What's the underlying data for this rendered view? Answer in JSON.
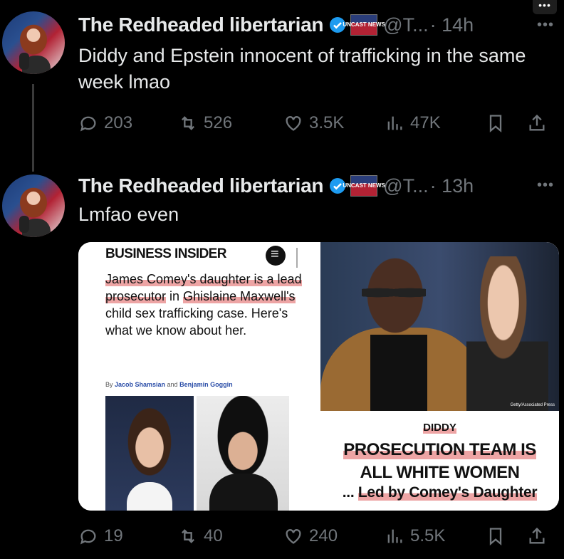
{
  "top_more": "•••",
  "tweets": [
    {
      "name": "The Redheaded libertarian",
      "badge": "UNCAST NEWS",
      "handle": "@T...",
      "time": "· 14h",
      "more": "•••",
      "text": "Diddy and Epstein innocent of trafficking in the same week lmao",
      "replies": "203",
      "reposts": "526",
      "likes": "3.5K",
      "views": "47K"
    },
    {
      "name": "The Redheaded libertarian",
      "badge": "UNCAST NEWS",
      "handle": "@T...",
      "time": "· 13h",
      "more": "•••",
      "text": "Lmfao even",
      "replies": "19",
      "reposts": "40",
      "likes": "240",
      "views": "5.5K"
    }
  ],
  "media": {
    "left": {
      "brand": "BUSINESS INSIDER",
      "title_parts": [
        "James Comey's daughter",
        " is a lead prosecutor",
        " in ",
        "Ghislaine Maxwell's",
        " child sex trafficking case. Here's what we know about her."
      ],
      "byline_prefix": "By ",
      "author1": "Jacob Shamsian",
      "byline_and": " and ",
      "author2": "Benjamin Goggin"
    },
    "right": {
      "credit": "Getty/Associated Press",
      "line1": "DIDDY",
      "line2": "PROSECUTION TEAM IS",
      "line3": "ALL WHITE WOMEN",
      "line4_prefix": "... ",
      "line4": "Led by Comey's Daughter"
    }
  },
  "colors": {
    "background": "#000000",
    "text": "#e7e9ea",
    "muted": "#71767b",
    "verified": "#1d9bf0",
    "highlight": "#de5a5a"
  }
}
